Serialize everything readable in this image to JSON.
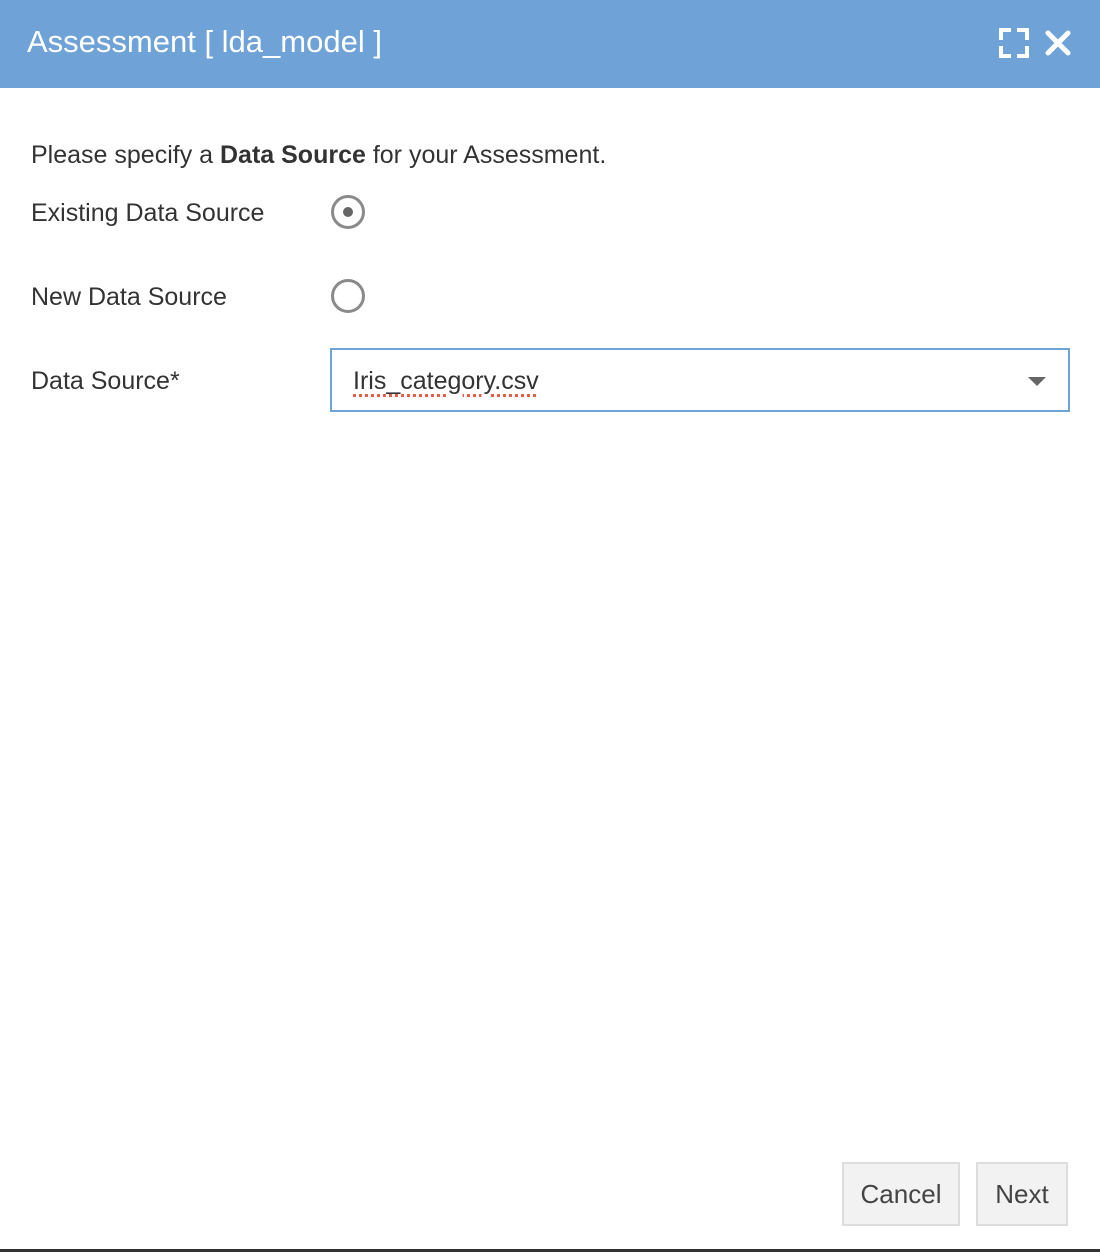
{
  "dialog": {
    "title": "Assessment [ lda_model ]",
    "icons": {
      "maximize": "maximize-icon",
      "close": "close-icon"
    }
  },
  "intro": {
    "prefix": "Please specify a ",
    "emphasis": "Data Source",
    "suffix": " for your Assessment."
  },
  "form": {
    "existing_label": "Existing Data Source",
    "existing_selected": true,
    "new_label": "New Data Source",
    "new_selected": false,
    "data_source_label": "Data Source*",
    "data_source_value": "Iris_category.csv"
  },
  "buttons": {
    "cancel": "Cancel",
    "next": "Next"
  },
  "colors": {
    "titlebar": "#6fa3d8",
    "select_border": "#6fa3d8",
    "spellcheck": "#e5604a"
  }
}
